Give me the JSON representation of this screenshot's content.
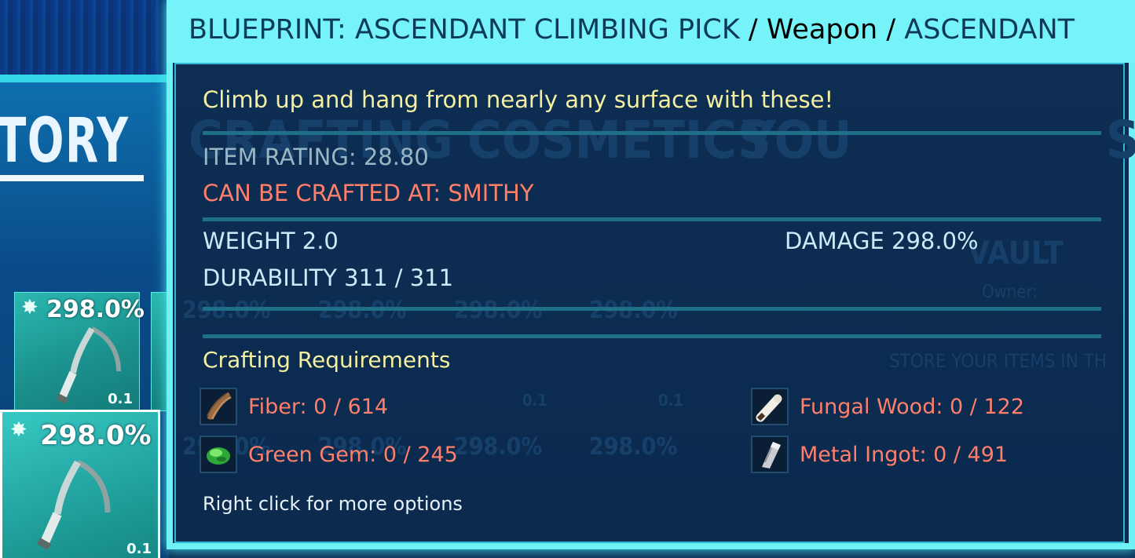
{
  "window": {
    "title_item": "BLUEPRINT: ASCENDANT CLIMBING PICK",
    "separator": "/",
    "title_category": "Weapon",
    "title_quality": "ASCENDANT"
  },
  "background": {
    "left_title": "TORY",
    "slots": [
      {
        "damage": "298.0%",
        "weight": "0.1",
        "selected": false
      },
      {
        "damage": "298.0%",
        "weight": "0.1",
        "selected": true
      }
    ],
    "ghost_tabs": [
      "CRAFTING",
      "COSMETICS",
      "YOU",
      "S"
    ],
    "vault_title": "VAULT",
    "vault_owner": "Owner:",
    "vault_hint": "STORE YOUR ITEMS IN TH",
    "ghost_damage": "298.0%",
    "ghost_weight": "0.1"
  },
  "tooltip": {
    "description": "Climb up and hang from nearly any surface with these!",
    "item_rating": "ITEM RATING: 28.80",
    "crafted_at": "CAN BE CRAFTED AT: SMITHY",
    "weight": "WEIGHT 2.0",
    "damage": "DAMAGE 298.0%",
    "durability": "DURABILITY 311 / 311",
    "crafting_header": "Crafting Requirements",
    "requirements": [
      {
        "label": "Fiber: 0 / 614",
        "icon": "fiber-icon"
      },
      {
        "label": "Fungal Wood: 0 / 122",
        "icon": "fungal-wood-icon"
      },
      {
        "label": "Green Gem: 0 / 245",
        "icon": "green-gem-icon"
      },
      {
        "label": "Metal Ingot: 0 / 491",
        "icon": "metal-ingot-icon"
      }
    ],
    "hint": "Right click for more options"
  },
  "colors": {
    "header_bg": "#76f3f8",
    "accent_border": "#6ef2f6",
    "description": "#f4f0a0",
    "requirement_missing": "#ff7f6a",
    "stat_text": "#c8ecf8"
  }
}
